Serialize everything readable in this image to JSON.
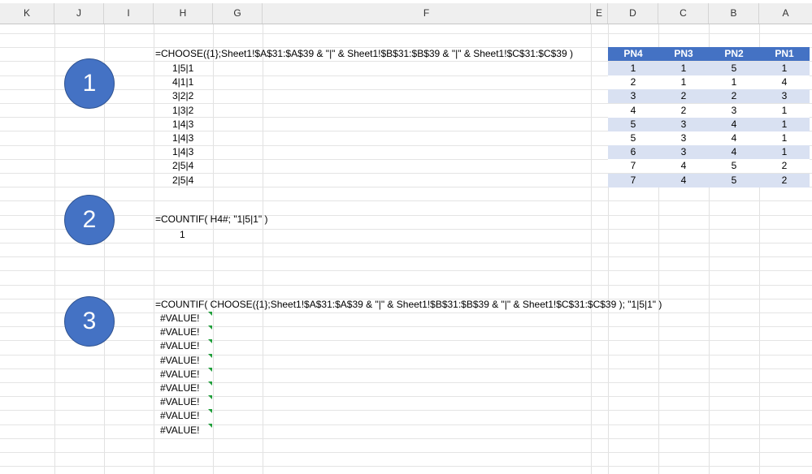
{
  "columns": [
    "K",
    "J",
    "I",
    "H",
    "G",
    "F",
    "E",
    "D",
    "C",
    "B",
    "A"
  ],
  "markers": [
    "1",
    "2",
    "3"
  ],
  "section1": {
    "formula": "=CHOOSE({1};Sheet1!$A$31:$A$39 & \"|\" & Sheet1!$B$31:$B$39 & \"|\" & Sheet1!$C$31:$C$39 )",
    "results": [
      "1|5|1",
      "4|1|1",
      "3|2|2",
      "1|3|2",
      "1|4|3",
      "1|4|3",
      "1|4|3",
      "2|5|4",
      "2|5|4"
    ]
  },
  "section2": {
    "formula": "=COUNTIF( H4#; \"1|5|1\" )",
    "result": "1"
  },
  "section3": {
    "formula": "=COUNTIF( CHOOSE({1};Sheet1!$A$31:$A$39 & \"|\" & Sheet1!$B$31:$B$39 & \"|\" & Sheet1!$C$31:$C$39 ); \"1|5|1\" )",
    "results": [
      "#VALUE!",
      "#VALUE!",
      "#VALUE!",
      "#VALUE!",
      "#VALUE!",
      "#VALUE!",
      "#VALUE!",
      "#VALUE!",
      "#VALUE!"
    ]
  },
  "table": {
    "headers": [
      "PN4",
      "PN3",
      "PN2",
      "PN1"
    ],
    "rows": [
      [
        "1",
        "1",
        "5",
        "1"
      ],
      [
        "2",
        "1",
        "1",
        "4"
      ],
      [
        "3",
        "2",
        "2",
        "3"
      ],
      [
        "4",
        "2",
        "3",
        "1"
      ],
      [
        "5",
        "3",
        "4",
        "1"
      ],
      [
        "5",
        "3",
        "4",
        "1"
      ],
      [
        "6",
        "3",
        "4",
        "1"
      ],
      [
        "7",
        "4",
        "5",
        "2"
      ],
      [
        "7",
        "4",
        "5",
        "2"
      ]
    ]
  },
  "colors": {
    "header_fill": "#4472c4",
    "band_fill": "#d9e1f2",
    "circle_fill": "#4472c4",
    "error_flag": "#1f9e3a"
  }
}
